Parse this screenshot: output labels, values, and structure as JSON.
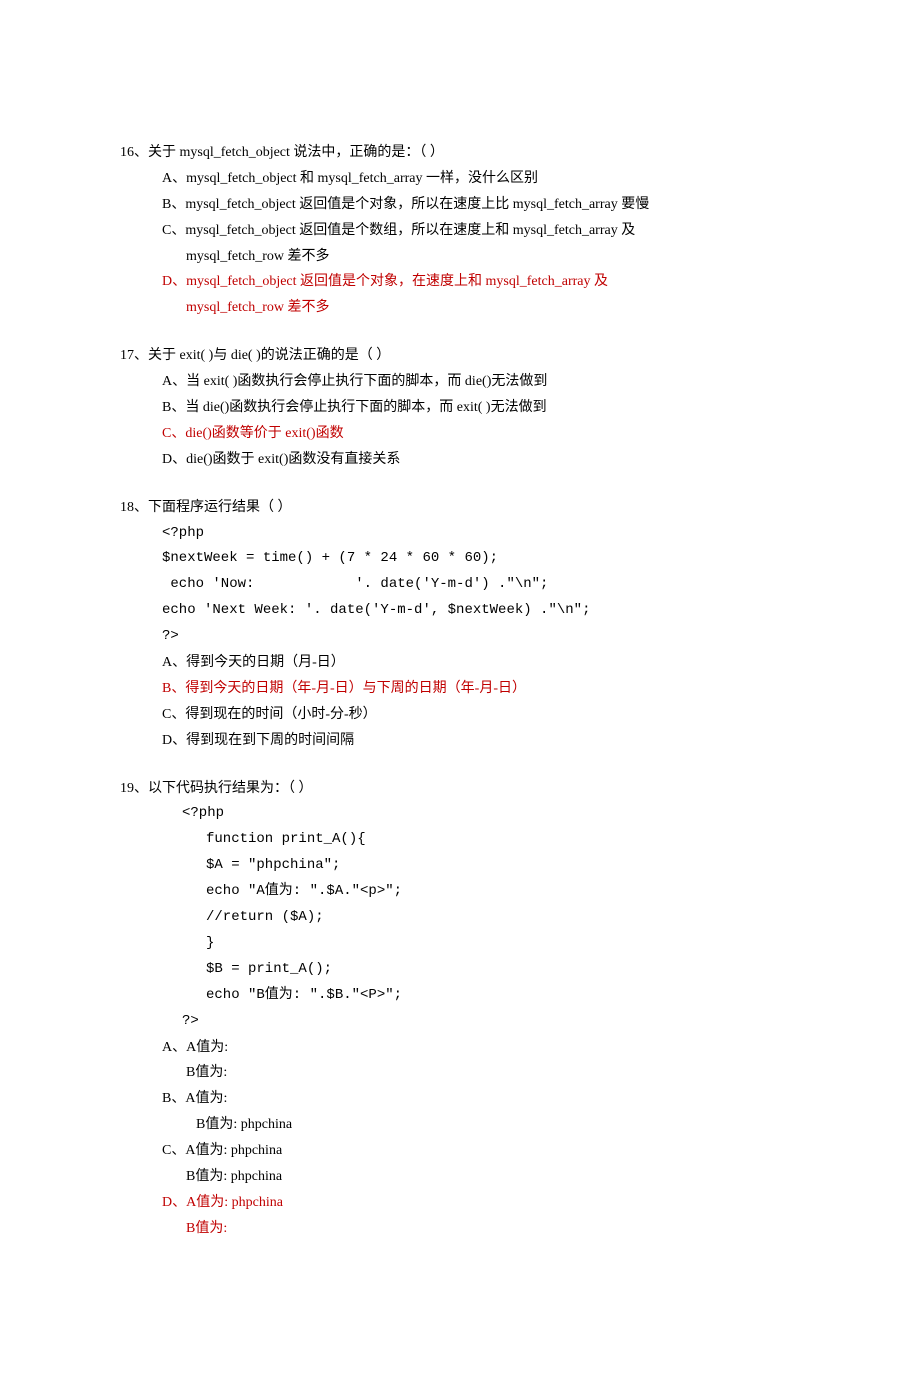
{
  "q16": {
    "stem": "16、关于 mysql_fetch_object 说法中，正确的是：（   ）",
    "a": "A、mysql_fetch_object 和 mysql_fetch_array 一样，没什么区别",
    "b": "B、mysql_fetch_object 返回值是个对象，所以在速度上比 mysql_fetch_array 要慢",
    "c_l1": "C、mysql_fetch_object 返回值是个数组，所以在速度上和 mysql_fetch_array 及",
    "c_l2": "mysql_fetch_row 差不多",
    "d_l1": "D、mysql_fetch_object 返回值是个对象，在速度上和 mysql_fetch_array 及",
    "d_l2": "mysql_fetch_row 差不多"
  },
  "q17": {
    "stem": "17、关于 exit( )与 die( )的说法正确的是（   ）",
    "a": "A、当 exit( )函数执行会停止执行下面的脚本，而 die()无法做到",
    "b": "B、当 die()函数执行会停止执行下面的脚本，而 exit( )无法做到",
    "c": "C、die()函数等价于 exit()函数",
    "d": "D、die()函数于 exit()函数没有直接关系"
  },
  "q18": {
    "stem": "18、下面程序运行结果（   ）",
    "code1": "<?php",
    "code2": "$nextWeek = time() + (7 * 24 * 60 * 60);",
    "code3": " echo 'Now:            '. date('Y-m-d') .\"\\n\";",
    "code4": "echo 'Next Week: '. date('Y-m-d', $nextWeek) .\"\\n\";",
    "code5": "?>",
    "a": "A、得到今天的日期（月-日）",
    "b": "B、得到今天的日期（年-月-日）与下周的日期（年-月-日）",
    "c": "C、得到现在的时间（小时-分-秒）",
    "d": "D、得到现在到下周的时间间隔"
  },
  "q19": {
    "stem": "19、以下代码执行结果为：（   ）",
    "code1": "<?php",
    "code2": "function print_A(){",
    "code3": "$A = \"phpchina\";",
    "code4": "echo \"A值为: \".$A.\"<p>\";",
    "code5": " //return ($A);",
    "code6": "}",
    "code7": "$B = print_A();",
    "code8": "echo \"B值为: \".$B.\"<P>\";",
    "code9": "?>",
    "a": "A、A值为:",
    "a_sub": "B值为:",
    "b": "B、A值为:",
    "b_sub": "B值为: phpchina",
    "c": "C、A值为: phpchina",
    "c_sub": "B值为: phpchina",
    "d": "D、A值为: phpchina",
    "d_sub": "B值为:"
  }
}
